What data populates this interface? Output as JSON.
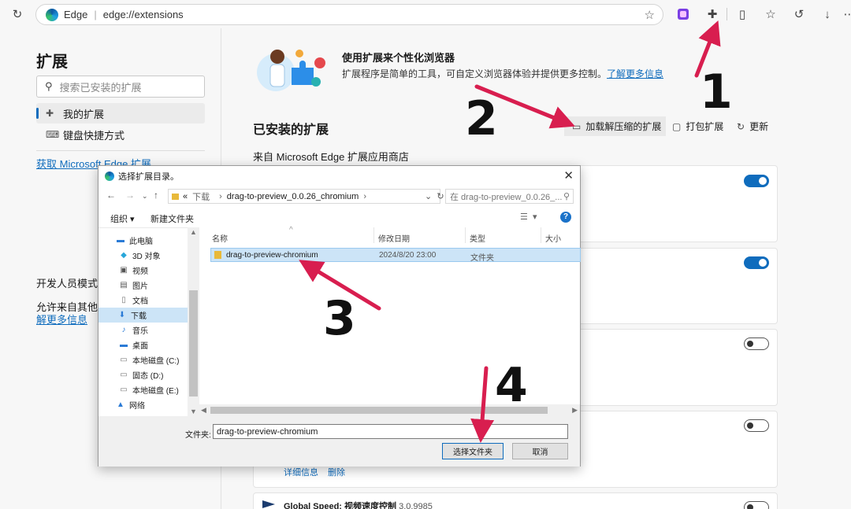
{
  "browser": {
    "site_name": "Edge",
    "url": "edge://extensions"
  },
  "sidebar": {
    "title": "扩展",
    "search_placeholder": "搜索已安装的扩展",
    "items": [
      {
        "label": "我的扩展"
      },
      {
        "label": "键盘快捷方式"
      }
    ],
    "get_extensions": "获取 Microsoft Edge 扩展",
    "dev_mode": "开发人员模式",
    "allow_text": "允许来自其他应",
    "learn_more": "解更多信息"
  },
  "main": {
    "hero_title": "使用扩展来个性化浏览器",
    "hero_desc": "扩展程序是简单的工具，可自定义浏览器体验并提供更多控制。",
    "hero_link": "了解更多信息",
    "installed_title": "已安装的扩展",
    "load_unpacked": "加载解压缩的扩展",
    "pack": "打包扩展",
    "update": "更新",
    "from_store": "来自 Microsoft Edge 扩展应用商店",
    "card_links": {
      "details": "详细信息",
      "remove": "删除"
    },
    "last_ext": {
      "name": "Global Speed: ",
      "name_cn": "视频速度控制",
      "version": " 3.0.9985"
    },
    "toggles": [
      true,
      true,
      false,
      false,
      false
    ]
  },
  "dialog": {
    "title": "选择扩展目录。",
    "path": [
      "«",
      "下载",
      "drag-to-preview_0.0.26_chromium"
    ],
    "search_placeholder": "在 drag-to-preview_0.0.26_...",
    "organize": "组织 ▾",
    "new_folder": "新建文件夹",
    "tree": [
      "此电脑",
      "3D 对象",
      "视频",
      "图片",
      "文档",
      "下载",
      "音乐",
      "桌面",
      "本地磁盘 (C:)",
      "固态 (D:)",
      "本地磁盘 (E:)",
      "网络"
    ],
    "tree_selected": 5,
    "columns": [
      "名称",
      "修改日期",
      "类型",
      "大小"
    ],
    "rows": [
      {
        "name": "drag-to-preview-chromium",
        "date": "2024/8/20 23:00",
        "type": "文件夹"
      }
    ],
    "filename_label": "文件夹:",
    "filename_value": "drag-to-preview-chromium",
    "ok": "选择文件夹",
    "cancel": "取消"
  },
  "annotations": {
    "numbers": [
      "1",
      "2",
      "3",
      "4"
    ],
    "arrow_color": "#d81e4f"
  }
}
